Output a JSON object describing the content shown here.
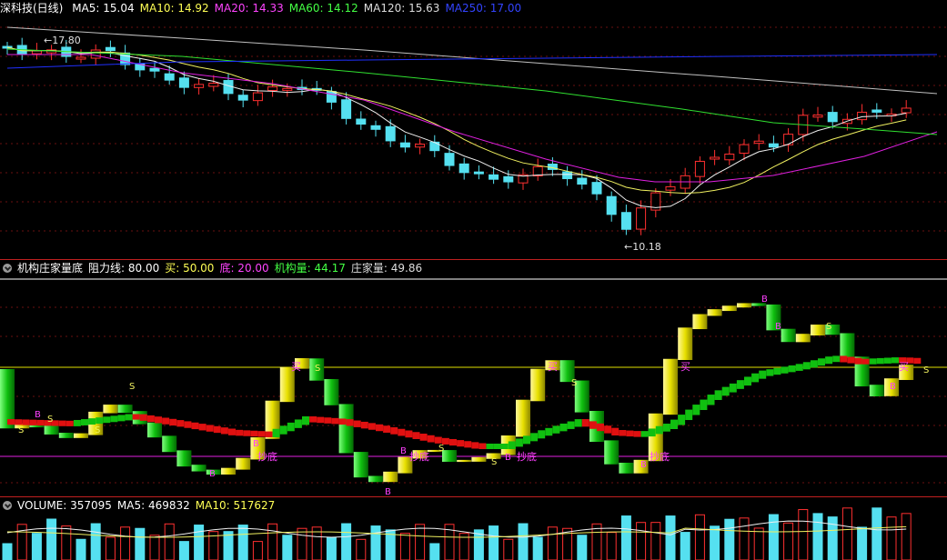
{
  "main": {
    "symbol": "深科技(日线)",
    "indicators": [
      {
        "text": "MA5: 15.04",
        "color": "#ffffff"
      },
      {
        "text": "MA10: 14.92",
        "color": "#ffff55"
      },
      {
        "text": "MA20: 14.33",
        "color": "#ff44ff"
      },
      {
        "text": "MA60: 14.12",
        "color": "#44ff44"
      },
      {
        "text": "MA120: 15.63",
        "color": "#dddddd"
      },
      {
        "text": "MA250: 17.00",
        "color": "#3344ff"
      }
    ],
    "high_label": "17.80",
    "low_label": "10.18"
  },
  "indicator_panel": {
    "name": "机构庄家量底",
    "values": [
      {
        "text": "阻力线: 80.00",
        "color": "#ffffff"
      },
      {
        "text": "买: 50.00",
        "color": "#ffff55"
      },
      {
        "text": "底: 20.00",
        "color": "#ff44ff"
      },
      {
        "text": "机构量: 44.17",
        "color": "#44ff44"
      },
      {
        "text": "庄家量: 49.86",
        "color": "#dddddd"
      }
    ],
    "buy_marker": "买",
    "bottom_marker": "抄底",
    "sell_marker": "B",
    "cross_marker": "S"
  },
  "volume_panel": {
    "label": "VOLUME: 357095",
    "ma5": "MA5: 469832",
    "ma10": "MA10: 517627"
  },
  "colors": {
    "up": "#ff3030",
    "down": "#55e0f0",
    "resistance": "#ffffff",
    "buy_line": "#e0e000",
    "bottom_line": "#e020e0",
    "separator": "#c02020"
  }
}
